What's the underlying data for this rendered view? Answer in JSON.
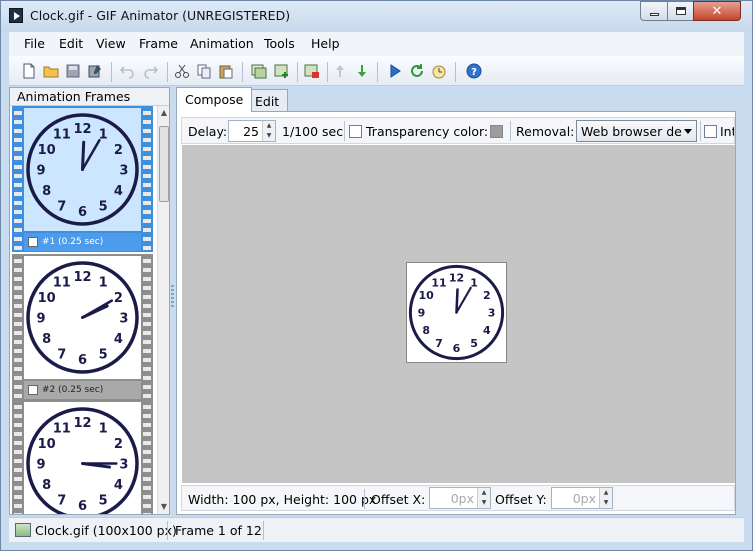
{
  "window": {
    "title": "Clock.gif - GIF Animator (UNREGISTERED)"
  },
  "menu": [
    "File",
    "Edit",
    "View",
    "Frame",
    "Animation",
    "Tools",
    "Help"
  ],
  "toolbar_icons": [
    "new-file-icon",
    "open-folder-icon",
    "save-icon",
    "save-as-icon",
    "undo-icon",
    "redo-icon",
    "cut-icon",
    "copy-icon",
    "paste-icon",
    "duplicate-frame-icon",
    "add-frame-icon",
    "delete-frame-icon",
    "move-up-icon",
    "move-down-icon",
    "play-icon",
    "refresh-icon",
    "timer-icon",
    "help-icon"
  ],
  "left_panel": {
    "title": "Animation Frames",
    "frames": [
      {
        "label": "#1 (0.25 sec)",
        "hour": 12,
        "minute": 5,
        "selected": true
      },
      {
        "label": "#2 (0.25 sec)",
        "hour": 2,
        "minute": 10,
        "selected": false
      },
      {
        "label": "",
        "hour": 3,
        "minute": 15,
        "selected": false
      }
    ]
  },
  "tabs": [
    "Compose",
    "Edit"
  ],
  "options": {
    "delay_label": "Delay:",
    "delay_value": "25",
    "delay_unit": "1/100 sec",
    "transparency_label": "Transparency color:",
    "removal_label": "Removal:",
    "removal_value": "Web browser de",
    "extra_label": "Int"
  },
  "preview": {
    "hour": 12,
    "minute": 5
  },
  "info": {
    "size_text": "Width: 100 px, Height: 100 px",
    "offset_x_label": "Offset X:",
    "offset_x_value": "0px",
    "offset_y_label": "Offset Y:",
    "offset_y_value": "0px"
  },
  "status": {
    "file": "Clock.gif (100x100 px)",
    "frame": "Frame 1 of 12"
  },
  "colors": {
    "clock_navy": "#1b1b4a",
    "selection_blue": "#3f8fde",
    "canvas_gray": "#c5c5c5"
  }
}
